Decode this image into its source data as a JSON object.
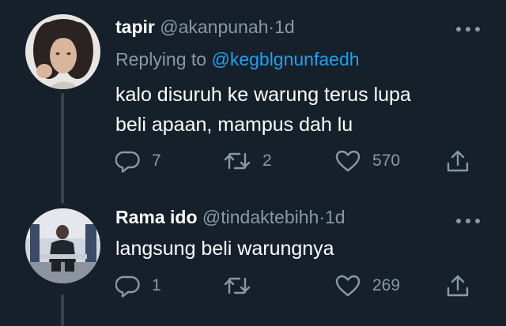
{
  "tweets": [
    {
      "display_name": "tapir",
      "handle": "@akanpunah",
      "separator": "·",
      "time": "1d",
      "replying_prefix": "Replying to",
      "replying_to": "@kegblgnunfaedh",
      "body_lines": [
        "kalo disuruh ke warung terus lupa",
        "beli apaan, mampus dah lu"
      ],
      "counts": {
        "replies": "7",
        "retweets": "2",
        "likes": "570"
      }
    },
    {
      "display_name": "Rama ido",
      "handle": "@tindaktebihh",
      "separator": "·",
      "time": "1d",
      "body_lines": [
        "langsung beli warungnya"
      ],
      "counts": {
        "replies": "1",
        "retweets": "",
        "likes": "269"
      }
    }
  ],
  "icons": {
    "reply": "reply-icon",
    "retweet": "retweet-icon",
    "like": "heart-icon",
    "share": "share-icon",
    "more": "more-icon"
  },
  "colors": {
    "background": "#15202b",
    "text_primary": "#ffffff",
    "text_secondary": "#8899a6",
    "accent": "#1da1f2",
    "thread_line": "#38444d"
  }
}
